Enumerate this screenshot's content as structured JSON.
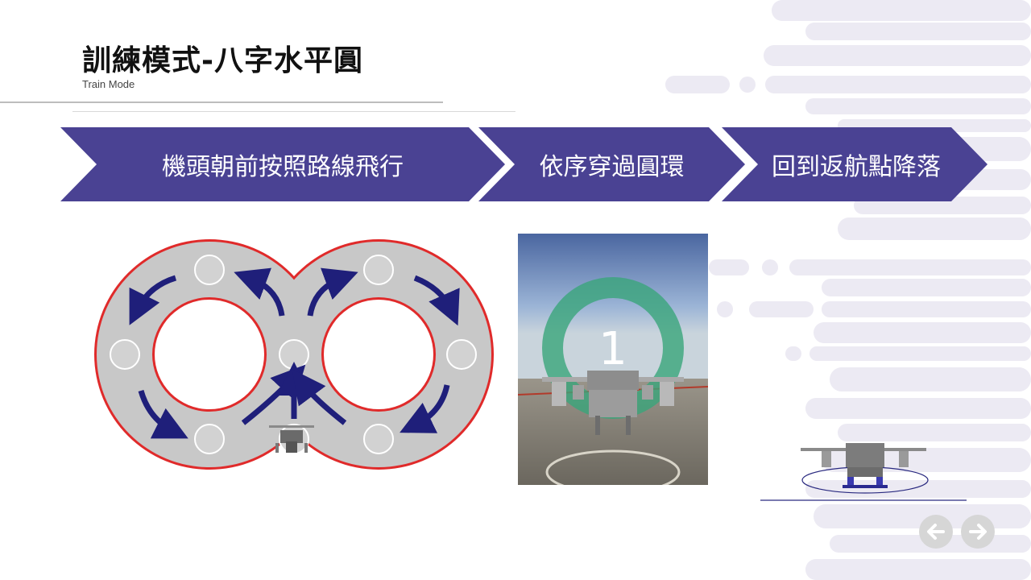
{
  "slide": {
    "title": "訓練模式-八字水平圓",
    "subtitle": "Train Mode"
  },
  "steps": [
    {
      "label": "機頭朝前按照路線飛行"
    },
    {
      "label": "依序穿過圓環"
    },
    {
      "label": "回到返航點降落"
    }
  ],
  "sim_image": {
    "ring_number": "1"
  },
  "nav": {
    "prev_icon": "arrow-left-icon",
    "next_icon": "arrow-right-icon"
  },
  "colors": {
    "accent": "#4a4293",
    "track_outline": "#e02a2a",
    "arrow": "#1f1f7a",
    "track_fill": "#c8c8c8"
  }
}
